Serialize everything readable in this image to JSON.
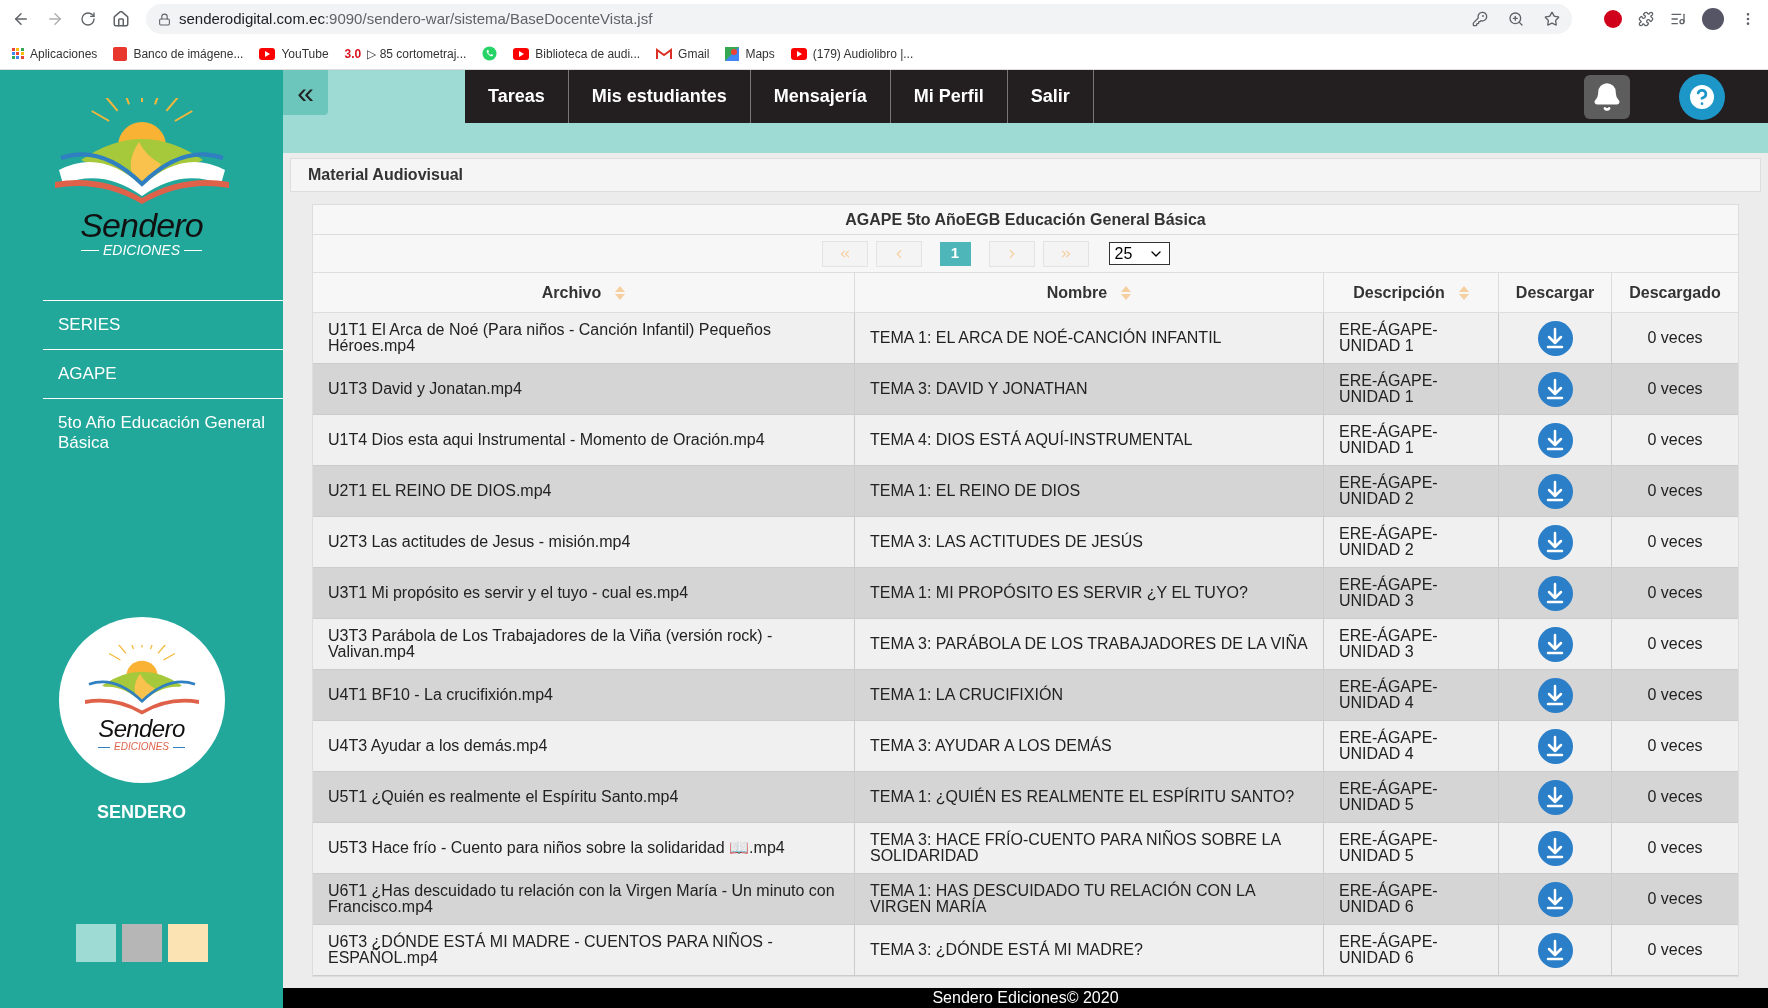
{
  "browser": {
    "url_host": "senderodigital.com.ec",
    "url_path": ":9090/sendero-war/sistema/BaseDocenteVista.jsf",
    "bookmarks": [
      {
        "kind": "apps",
        "label": "Aplicaciones"
      },
      {
        "kind": "red",
        "label": "Banco de imágene..."
      },
      {
        "kind": "youtube",
        "label": "YouTube"
      },
      {
        "kind": "text",
        "badge": "3.0",
        "label": "▷ 85 cortometraj..."
      },
      {
        "kind": "whatsapp"
      },
      {
        "kind": "youtube",
        "label": "Biblioteca de audi..."
      },
      {
        "kind": "gmail",
        "label": "Gmail"
      },
      {
        "kind": "maps",
        "label": "Maps"
      },
      {
        "kind": "youtube",
        "label": "(179) Audiolibro |..."
      }
    ]
  },
  "sidebar": {
    "logo": {
      "name": "Sendero",
      "subtitle": "EDICIONES"
    },
    "items": [
      {
        "label": "SERIES"
      },
      {
        "label": "AGAPE"
      },
      {
        "label": "5to Año Educación General Básica"
      }
    ],
    "badge_logo": {
      "name": "Sendero",
      "subtitle": "EDICIONES"
    },
    "brand": "SENDERO",
    "swatches": [
      {
        "color": "#9fdbd5"
      },
      {
        "color": "#b6b6b6"
      },
      {
        "color": "#fbe3b3"
      }
    ]
  },
  "nav": {
    "toggle": "«",
    "items": [
      "Tareas",
      "Mis estudiantes",
      "Mensajería",
      "Mi Perfil",
      "Salir"
    ]
  },
  "panel": {
    "title": "Material Audiovisual"
  },
  "table": {
    "caption": "AGAPE 5to AñoEGB Educación General Básica",
    "pages": [
      {
        "label": "1",
        "selected": true
      }
    ],
    "rows_per_page": "25",
    "columns": [
      {
        "label": "Archivo",
        "sortable": true
      },
      {
        "label": "Nombre",
        "sortable": true
      },
      {
        "label": "Descripción",
        "sortable": true
      },
      {
        "label": "Descargar",
        "sortable": false
      },
      {
        "label": "Descargado",
        "sortable": false
      }
    ],
    "rows": [
      {
        "archivo": "U1T1 El Arca de Noé (Para niños - Canción Infantil) Pequeños Héroes.mp4",
        "nombre": "TEMA 1: EL ARCA DE NOÉ-CANCIÓN INFANTIL",
        "descripcion": "ERE-ÁGAPE-UNIDAD 1",
        "descargado": "0 veces"
      },
      {
        "archivo": "U1T3 David y Jonatan.mp4",
        "nombre": "TEMA 3: DAVID Y JONATHAN",
        "descripcion": "ERE-ÁGAPE-UNIDAD 1",
        "descargado": "0 veces"
      },
      {
        "archivo": "U1T4 Dios esta aqui Instrumental - Momento de Oración.mp4",
        "nombre": "TEMA 4: DIOS ESTÁ AQUÍ-INSTRUMENTAL",
        "descripcion": "ERE-ÁGAPE-UNIDAD 1",
        "descargado": "0 veces"
      },
      {
        "archivo": "U2T1 EL REINO DE DIOS.mp4",
        "nombre": "TEMA 1: EL REINO DE DIOS",
        "descripcion": "ERE-ÁGAPE-UNIDAD 2",
        "descargado": "0 veces"
      },
      {
        "archivo": "U2T3 Las actitudes de Jesus - misión.mp4",
        "nombre": "TEMA 3: LAS ACTITUDES DE JESÚS",
        "descripcion": "ERE-ÁGAPE-UNIDAD 2",
        "descargado": "0 veces"
      },
      {
        "archivo": "U3T1 Mi propósito es servir y el tuyo - cual es.mp4",
        "nombre": "TEMA 1: MI PROPÓSITO ES SERVIR ¿Y EL TUYO?",
        "descripcion": "ERE-ÁGAPE-UNIDAD 3",
        "descargado": "0 veces"
      },
      {
        "archivo": "U3T3 Parábola de Los Trabajadores de la Viña (versión rock) - Valivan.mp4",
        "nombre": "TEMA 3: PARÁBOLA DE LOS TRABAJADORES DE LA VIÑA",
        "descripcion": "ERE-ÁGAPE-UNIDAD 3",
        "descargado": "0 veces"
      },
      {
        "archivo": "U4T1 BF10 - La crucifixión.mp4",
        "nombre": "TEMA 1: LA CRUCIFIXIÓN",
        "descripcion": "ERE-ÁGAPE-UNIDAD 4",
        "descargado": "0 veces"
      },
      {
        "archivo": "U4T3 Ayudar a los demás.mp4",
        "nombre": "TEMA 3: AYUDAR A LOS DEMÁS",
        "descripcion": "ERE-ÁGAPE-UNIDAD 4",
        "descargado": "0 veces"
      },
      {
        "archivo": "U5T1 ¿Quién es realmente el Espíritu Santo.mp4",
        "nombre": "TEMA 1: ¿QUIÉN ES REALMENTE EL ESPÍRITU SANTO?",
        "descripcion": "ERE-ÁGAPE-UNIDAD 5",
        "descargado": "0 veces"
      },
      {
        "archivo": "U5T3 Hace frío - Cuento para niños sobre la solidaridad 📖.mp4",
        "nombre": "TEMA 3: HACE FRÍO-CUENTO PARA NIÑOS SOBRE LA SOLIDARIDAD",
        "descripcion": "ERE-ÁGAPE-UNIDAD 5",
        "descargado": "0 veces"
      },
      {
        "archivo": "U6T1 ¿Has descuidado tu relación con la Virgen María - Un minuto con Francisco.mp4",
        "nombre": "TEMA 1: HAS DESCUIDADO TU RELACIÓN CON LA VIRGEN MARÍA",
        "descripcion": "ERE-ÁGAPE-UNIDAD 6",
        "descargado": "0 veces"
      },
      {
        "archivo": "U6T3 ¿DÓNDE ESTÁ MI MADRE - CUENTOS PARA NIÑOS - ESPAÑOL.mp4",
        "nombre": "TEMA 3: ¿DÓNDE ESTÁ MI MADRE?",
        "descripcion": "ERE-ÁGAPE-UNIDAD 6",
        "descargado": "0 veces"
      }
    ]
  },
  "footer": "Sendero Ediciones© 2020"
}
